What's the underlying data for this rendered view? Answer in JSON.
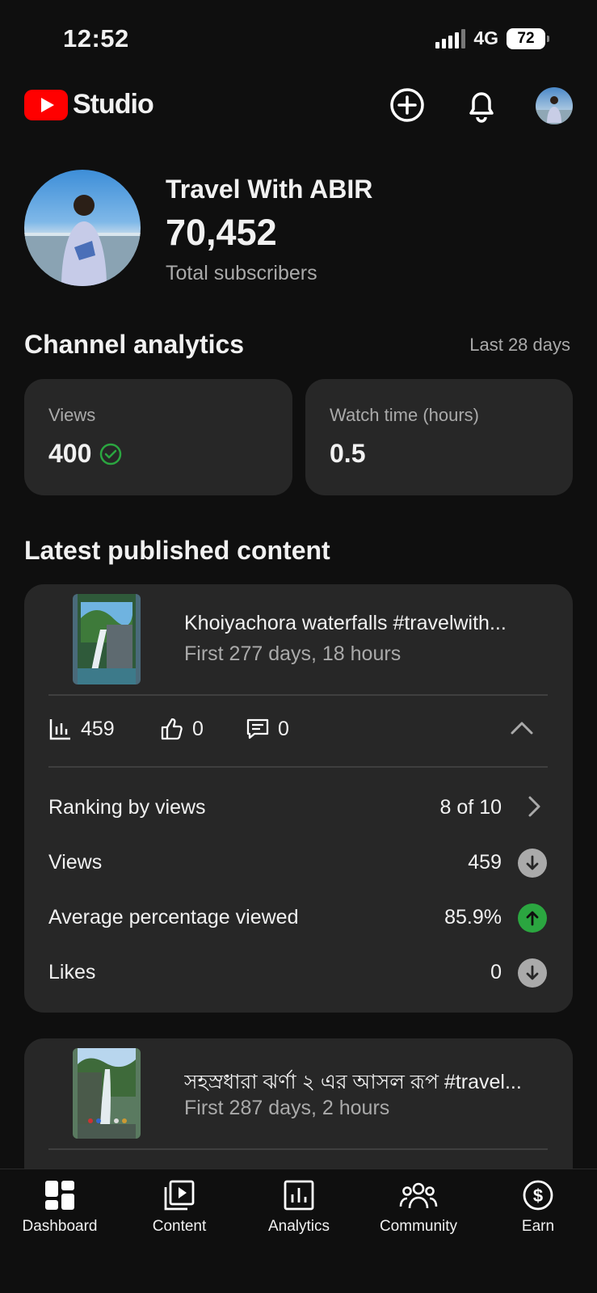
{
  "status_bar": {
    "time": "12:52",
    "network": "4G",
    "battery": "72"
  },
  "header": {
    "logo_text": "Studio",
    "icons": [
      "create-icon",
      "notifications-icon",
      "account-avatar"
    ]
  },
  "channel": {
    "name": "Travel With ABIR",
    "subscriber_count": "70,452",
    "subscriber_label": "Total subscribers"
  },
  "analytics": {
    "title": "Channel analytics",
    "period": "Last 28 days",
    "cards": [
      {
        "label": "Views",
        "value": "400",
        "status_icon": "check-circle-icon"
      },
      {
        "label": "Watch time (hours)",
        "value": "0.5"
      }
    ]
  },
  "latest": {
    "title": "Latest published content",
    "videos": [
      {
        "title": "Khoiyachora waterfalls #travelwith...",
        "subtitle": "First 277 days, 18 hours",
        "views": "459",
        "likes": "0",
        "comments": "0",
        "rows": [
          {
            "label": "Ranking by views",
            "value": "8 of 10",
            "indicator": "chevron-right"
          },
          {
            "label": "Views",
            "value": "459",
            "indicator": "down"
          },
          {
            "label": "Average percentage viewed",
            "value": "85.9%",
            "indicator": "up"
          },
          {
            "label": "Likes",
            "value": "0",
            "indicator": "down"
          }
        ]
      },
      {
        "title": "সহস্রধারা ঝর্ণা ২ এর আসল রূপ #travel...",
        "subtitle": "First 287 days, 2 hours"
      }
    ]
  },
  "nav": {
    "items": [
      {
        "label": "Dashboard",
        "icon": "dashboard-icon"
      },
      {
        "label": "Content",
        "icon": "content-icon"
      },
      {
        "label": "Analytics",
        "icon": "analytics-icon"
      },
      {
        "label": "Community",
        "icon": "community-icon"
      },
      {
        "label": "Earn",
        "icon": "earn-icon"
      }
    ]
  },
  "colors": {
    "background": "#0f0f0f",
    "card": "#272727",
    "brand_red": "#ff0000",
    "success_green": "#2ba640",
    "neutral_indicator": "#aaaaaa"
  }
}
